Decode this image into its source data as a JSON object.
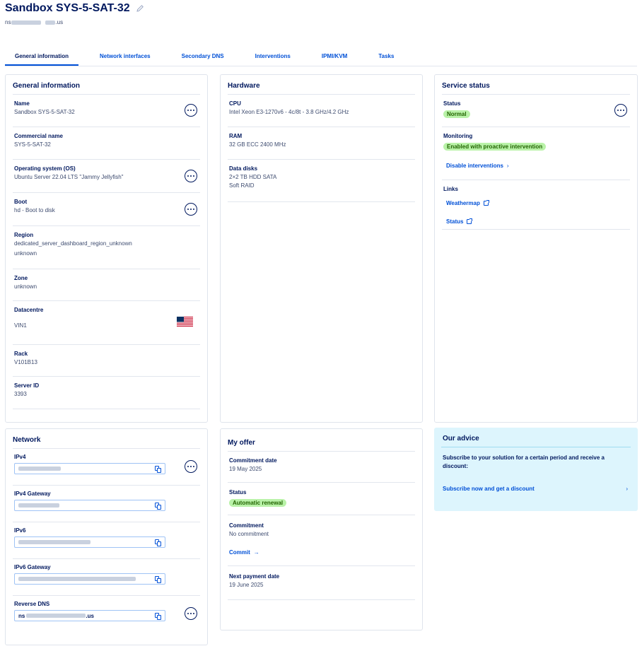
{
  "page": {
    "title": "Sandbox SYS-5-SAT-32",
    "hostname_prefix": "ns",
    "hostname_suffix": ".us"
  },
  "tabs": [
    {
      "label": "General information",
      "active": true
    },
    {
      "label": "Network interfaces"
    },
    {
      "label": "Secondary DNS"
    },
    {
      "label": "Interventions"
    },
    {
      "label": "IPMI/KVM"
    },
    {
      "label": "Tasks"
    }
  ],
  "general": {
    "title": "General information",
    "rows": [
      {
        "label": "Name",
        "value": "Sandbox SYS-5-SAT-32"
      },
      {
        "label": "Commercial name",
        "value": "SYS-5-SAT-32"
      },
      {
        "label": "Operating system (OS)",
        "value": "Ubuntu Server 22.04 LTS \"Jammy Jellyfish\""
      },
      {
        "label": "Boot",
        "value": "hd - Boot to disk"
      },
      {
        "label": "Region",
        "value": "dedicated_server_dashboard_region_unknown",
        "value2": "unknown"
      },
      {
        "label": "Zone",
        "value": "unknown"
      },
      {
        "label": "Datacentre",
        "value": "VIN1"
      },
      {
        "label": "Rack",
        "value": "V101B13"
      },
      {
        "label": "Server ID",
        "value": "3393"
      }
    ]
  },
  "hardware": {
    "title": "Hardware",
    "rows": [
      {
        "label": "CPU",
        "value": "Intel Xeon E3-1270v6 - 4c/8t - 3.8 GHz/4.2 GHz"
      },
      {
        "label": "RAM",
        "value": "32 GB ECC 2400 MHz"
      },
      {
        "label": "Data disks",
        "value": "2×2 TB HDD SATA",
        "value2": "Soft RAID"
      }
    ]
  },
  "service": {
    "title": "Service status",
    "status_label": "Status",
    "status_value": "Normal",
    "monitoring_label": "Monitoring",
    "monitoring_value": "Enabled with proactive intervention",
    "disable_link": "Disable interventions",
    "links_label": "Links",
    "link_weathermap": "Weathermap",
    "link_status": "Status"
  },
  "network": {
    "title": "Network",
    "rows": [
      {
        "label": "IPv4"
      },
      {
        "label": "IPv4 Gateway"
      },
      {
        "label": "IPv6"
      },
      {
        "label": "IPv6 Gateway"
      },
      {
        "label": "Reverse DNS",
        "prefix": "ns",
        "suffix": ".us"
      }
    ]
  },
  "offer": {
    "title": "My offer",
    "commitment_date_label": "Commitment date",
    "commitment_date_value": "19 May 2025",
    "status_label": "Status",
    "status_value": "Automatic renewal",
    "commitment_label": "Commitment",
    "commitment_value": "No commitment",
    "commit_link": "Commit",
    "next_payment_label": "Next payment date",
    "next_payment_value": "19 June 2025"
  },
  "advice": {
    "title": "Our advice",
    "text": "Subscribe to your solution for a certain period and receive a discount:",
    "link": "Subscribe now and get a discount"
  },
  "colors": {
    "accent": "#0050d7",
    "ink": "#00185e",
    "success_bg": "#b9f2a8",
    "advice_bg": "#ddf5fd"
  }
}
